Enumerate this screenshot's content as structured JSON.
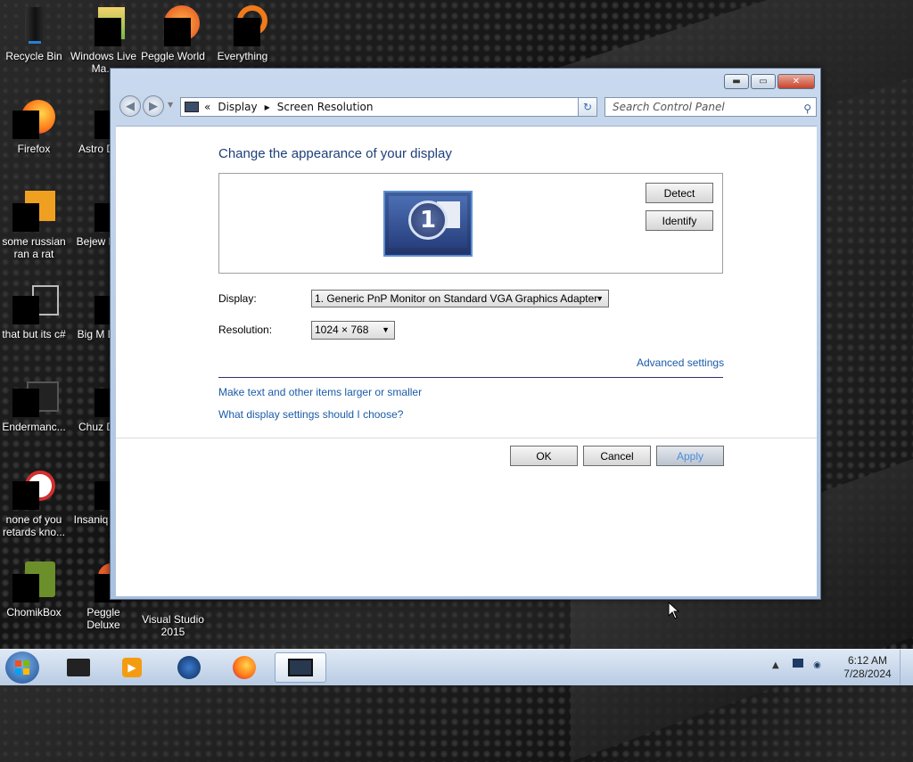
{
  "desktop": {
    "icons": [
      {
        "label": "Recycle Bin"
      },
      {
        "label": "Windows Live Ma..."
      },
      {
        "label": "Peggle World"
      },
      {
        "label": "Everything"
      },
      {
        "label": "Firefox"
      },
      {
        "label": "Astro Delu"
      },
      {
        "label": "some russian ran a rat"
      },
      {
        "label": "Bejew Delu"
      },
      {
        "label": "that but its c#"
      },
      {
        "label": "Big M Delu"
      },
      {
        "label": "Endermanc..."
      },
      {
        "label": "Chuz Delu"
      },
      {
        "label": "none of you retards kno..."
      },
      {
        "label": "Insaniq Delu"
      },
      {
        "label": "ChomikBox"
      },
      {
        "label": "Peggle Deluxe"
      },
      {
        "label": "Visual Studio 2015"
      }
    ]
  },
  "window": {
    "breadcrumb": {
      "sep": "«",
      "parent": "Display",
      "current": "Screen Resolution"
    },
    "search_placeholder": "Search Control Panel",
    "title": "Change the appearance of your display",
    "monitor_number": "1",
    "detect_label": "Detect",
    "identify_label": "Identify",
    "display_label": "Display:",
    "display_value": "1. Generic PnP Monitor on Standard VGA Graphics Adapter",
    "resolution_label": "Resolution:",
    "resolution_value": "1024 × 768",
    "advanced_link": "Advanced settings",
    "link_text_size": "Make text and other items larger or smaller",
    "link_help": "What display settings should I choose?",
    "ok_label": "OK",
    "cancel_label": "Cancel",
    "apply_label": "Apply"
  },
  "taskbar": {
    "time": "6:12 AM",
    "date": "7/28/2024"
  },
  "colors": {
    "title": "#1e3f7a",
    "link": "#1a5ba8",
    "taskbar": "#c9d9ee"
  }
}
